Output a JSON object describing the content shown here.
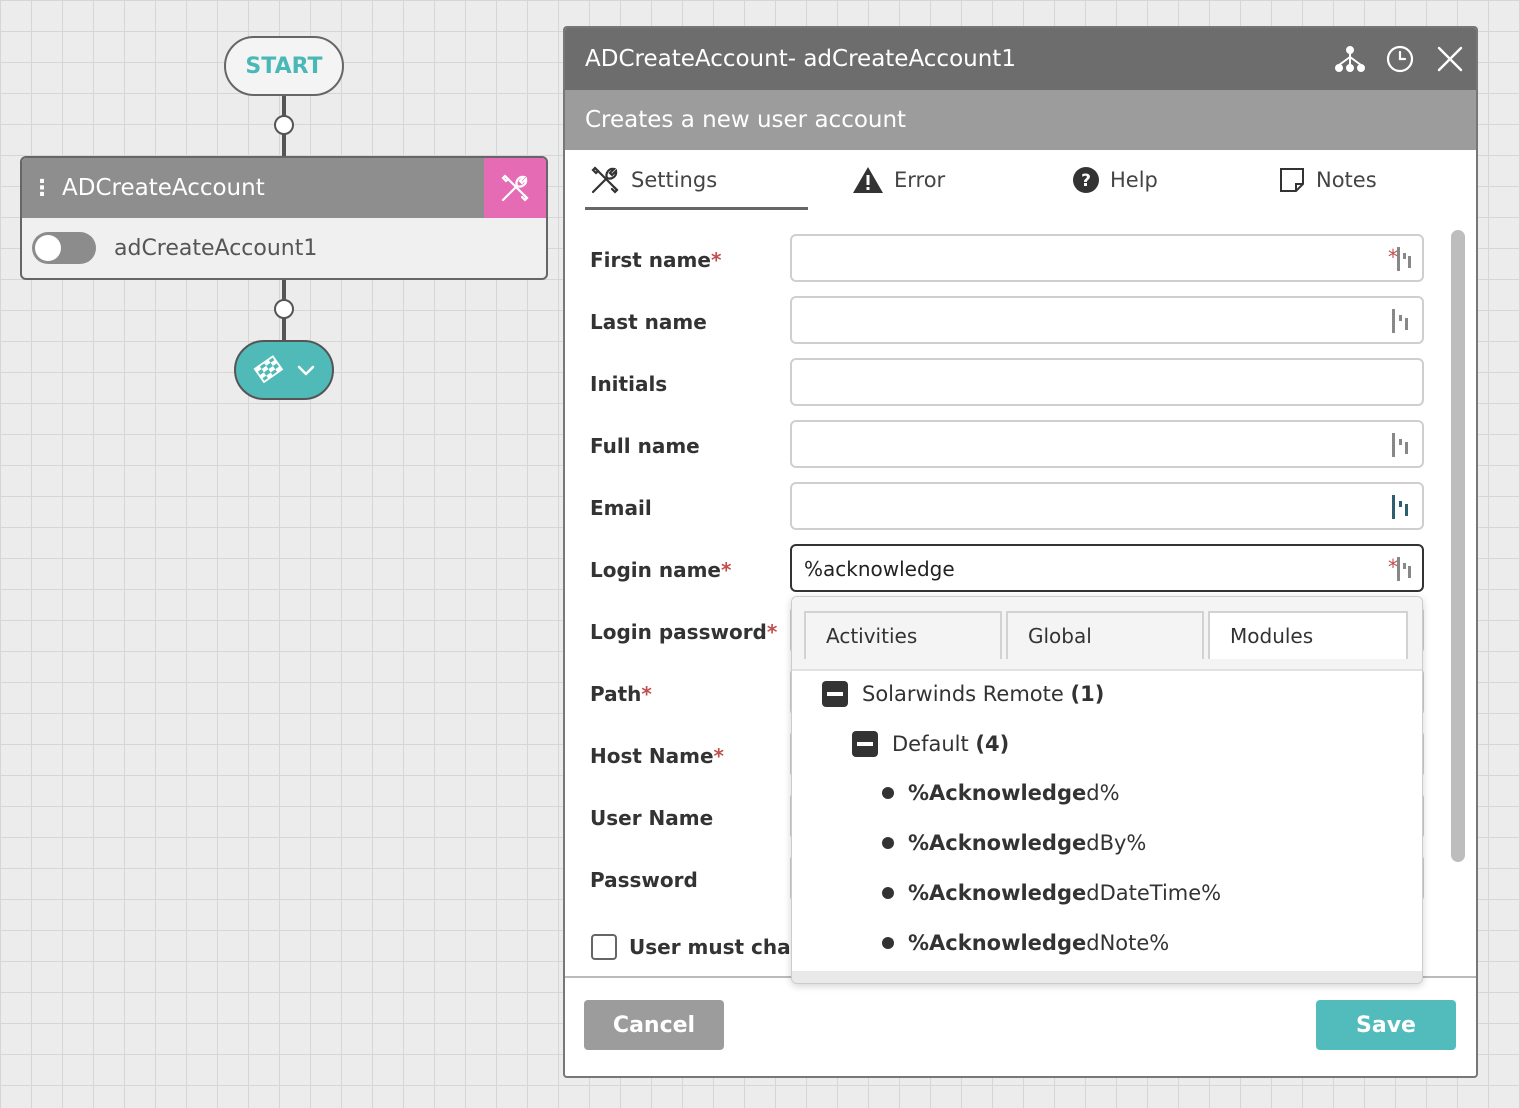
{
  "canvas": {
    "start_label": "START",
    "activity": {
      "title": "ADCreateAccount",
      "instance": "adCreateAccount1"
    }
  },
  "dialog": {
    "title": "ADCreateAccount-  adCreateAccount1",
    "description": "Creates a new user account",
    "tabs": [
      {
        "label": "Settings",
        "icon": "tools-icon",
        "active": true
      },
      {
        "label": "Error",
        "icon": "warning-icon",
        "active": false
      },
      {
        "label": "Help",
        "icon": "help-icon",
        "active": false
      },
      {
        "label": "Notes",
        "icon": "note-icon",
        "active": false
      }
    ],
    "required_mark": "*",
    "fields": [
      {
        "label": "First name",
        "required": true,
        "value": ""
      },
      {
        "label": "Last name",
        "required": false,
        "value": ""
      },
      {
        "label": "Initials",
        "required": false,
        "value": ""
      },
      {
        "label": "Full name",
        "required": false,
        "value": ""
      },
      {
        "label": "Email",
        "required": false,
        "value": ""
      },
      {
        "label": "Login name",
        "required": true,
        "value": "%acknowledge"
      },
      {
        "label": "Login password",
        "required": true,
        "value": ""
      },
      {
        "label": "Path",
        "required": true,
        "value": ""
      },
      {
        "label": "Host Name",
        "required": true,
        "value": ""
      },
      {
        "label": "User Name",
        "required": false,
        "value": ""
      },
      {
        "label": "Password",
        "required": false,
        "value": ""
      }
    ],
    "checkbox_label": "User must change",
    "cancel_label": "Cancel",
    "save_label": "Save",
    "accent_color": "#52bcbd",
    "activity_tool_color": "#e56cb4"
  },
  "autocomplete": {
    "tabs": [
      "Activities",
      "Global",
      "Modules"
    ],
    "group": {
      "name": "Solarwinds Remote",
      "count": "(1)"
    },
    "subgroup": {
      "name": "Default",
      "count": "(4)"
    },
    "items": [
      {
        "match": "%Acknowledge",
        "rest": "d%"
      },
      {
        "match": "%Acknowledge",
        "rest": "dBy%"
      },
      {
        "match": "%Acknowledge",
        "rest": "dDateTime%"
      },
      {
        "match": "%Acknowledge",
        "rest": "dNote%"
      }
    ]
  }
}
